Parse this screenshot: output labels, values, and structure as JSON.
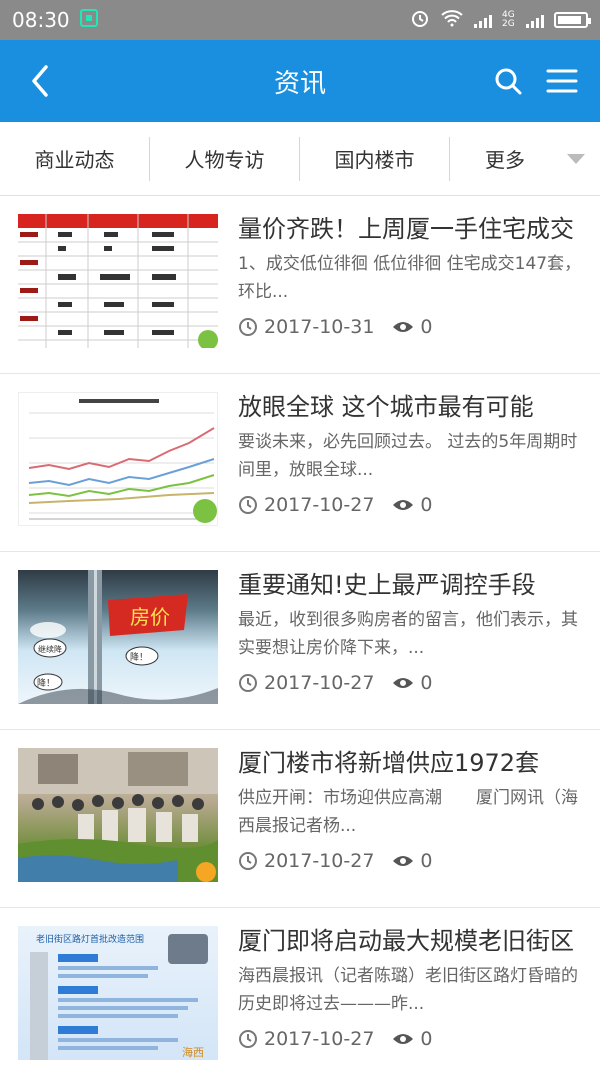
{
  "status_bar": {
    "time": "08:30",
    "network": "4G 2G"
  },
  "app_bar": {
    "title": "资讯"
  },
  "tabs": [
    {
      "label": "商业动态"
    },
    {
      "label": "人物专访"
    },
    {
      "label": "国内楼市"
    },
    {
      "label": "更多"
    }
  ],
  "news": [
    {
      "title": "量价齐跌！上周厦一手住宅成交",
      "summary": "1、成交低位徘徊 低位徘徊 住宅成交147套，环比...",
      "date": "2017-10-31",
      "views": "0",
      "thumb": "table"
    },
    {
      "title": "放眼全球 这个城市最有可能",
      "summary": "要谈未来，必先回顾过去。 过去的5年周期时间里，放眼全球...",
      "date": "2017-10-27",
      "views": "0",
      "thumb": "line-chart"
    },
    {
      "title": "重要通知!史上最严调控手段",
      "summary": "最近，收到很多购房者的留言，他们表示，其实要想让房价降下来，...",
      "date": "2017-10-27",
      "views": "0",
      "thumb": "cartoon",
      "thumb_text": [
        "房价",
        "继续降",
        "降！",
        "降！"
      ]
    },
    {
      "title": "厦门楼市将新增供应1972套",
      "summary": "供应开闸：市场迎供应高潮　　厦门网讯（海西晨报记者杨...",
      "date": "2017-10-27",
      "views": "0",
      "thumb": "photo"
    },
    {
      "title": "厦门即将启动最大规模老旧街区",
      "summary": "海西晨报讯（记者陈璐）老旧街区路灯昏暗的历史即将过去———昨...",
      "date": "2017-10-27",
      "views": "0",
      "thumb": "infographic",
      "thumb_text": [
        "老旧街区路灯首批改造范围",
        "海西"
      ]
    }
  ],
  "colors": {
    "app_bar": "#1a8fe0",
    "status_bar": "#8a8a8a"
  },
  "battery_level": 0.9
}
